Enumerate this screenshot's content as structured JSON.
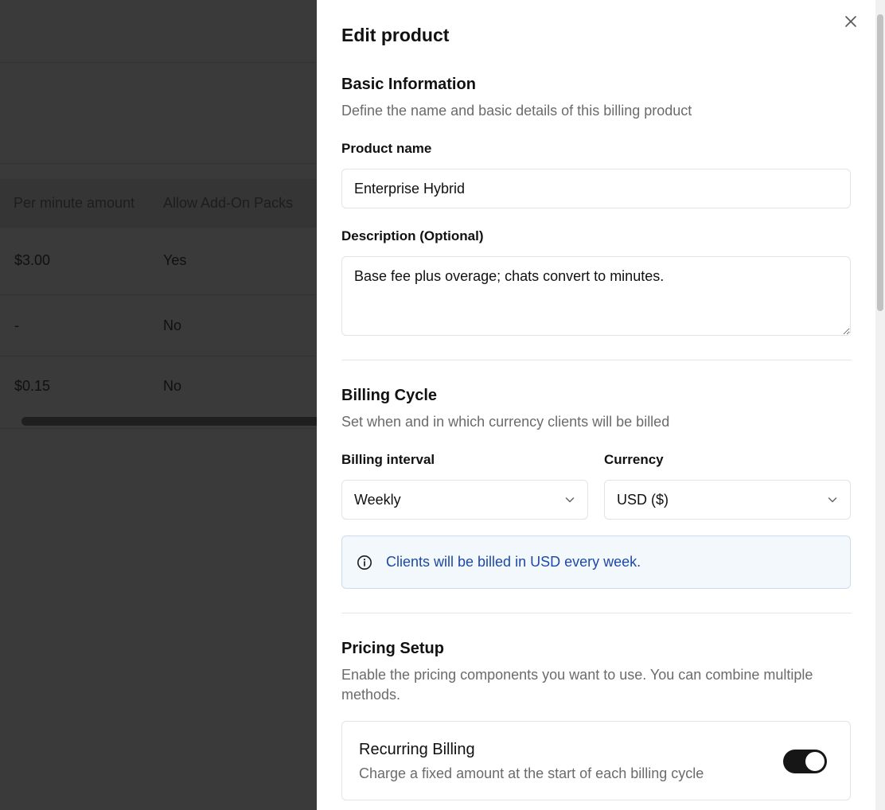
{
  "backdrop": {
    "table": {
      "headers": [
        "Per minute amount",
        "Allow Add-On Packs"
      ],
      "rows": [
        [
          "$3.00",
          "Yes"
        ],
        [
          "-",
          "No"
        ],
        [
          "$0.15",
          "No"
        ]
      ]
    }
  },
  "sheet": {
    "title": "Edit product",
    "close_icon": "close-icon",
    "basic": {
      "title": "Basic Information",
      "subtitle": "Define the name and basic details of this billing product",
      "name_label": "Product name",
      "name_value": "Enterprise Hybrid",
      "desc_label": "Description (Optional)",
      "desc_value": "Base fee plus overage; chats convert to minutes."
    },
    "billing": {
      "title": "Billing Cycle",
      "subtitle": "Set when and in which currency clients will be billed",
      "interval_label": "Billing interval",
      "interval_value": "Weekly",
      "currency_label": "Currency",
      "currency_value": "USD ($)",
      "info_text": "Clients will be billed in USD every week.",
      "info_icon": "info-icon"
    },
    "pricing": {
      "title": "Pricing Setup",
      "subtitle_line1": "Enable the pricing components you want to use. You can combine multiple",
      "subtitle_line2": "methods.",
      "recurring": {
        "title": "Recurring Billing",
        "subtitle": "Charge a fixed amount at the start of each billing cycle",
        "enabled": true
      }
    }
  },
  "colors": {
    "overlay": "#3a3a3a",
    "info_bg": "#f3f8fd",
    "info_border": "#c9dcf0",
    "info_text": "#1d49a6",
    "toggle_on": "#161616"
  }
}
